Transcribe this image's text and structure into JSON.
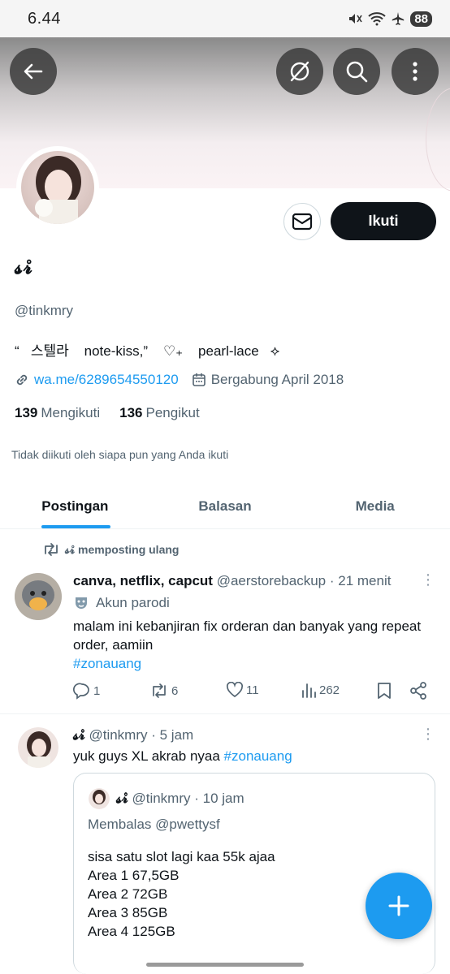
{
  "status_bar": {
    "time": "6.44",
    "battery": "88"
  },
  "profile": {
    "display_name": "𝓼𝓻̊",
    "handle": "@tinkmry",
    "bio": "“   스텔라    note-kiss,”    ♡₊    pearl-lace   ⟡",
    "link": "wa.me/6289654550120",
    "joined": "Bergabung April 2018",
    "following_count": "139",
    "following_label": "Mengikuti",
    "followers_count": "136",
    "followers_label": "Pengikut",
    "not_followed_text": "Tidak diikuti oleh siapa pun yang Anda ikuti",
    "follow_button": "Ikuti"
  },
  "tabs": [
    {
      "label": "Postingan"
    },
    {
      "label": "Balasan"
    },
    {
      "label": "Media"
    }
  ],
  "posts": [
    {
      "repost_label": "𝓼𝓻̊ memposting ulang",
      "name": "canva, netflix, capcut",
      "handle": "@aerstorebackup",
      "time": "· 21 menit",
      "badge": "Akun parodi",
      "text": "malam ini kebanjiran fix orderan dan banyak yang repeat order, aamiin",
      "hashtag": "#zonauang",
      "replies": "1",
      "reposts": "6",
      "likes": "11",
      "views": "262"
    },
    {
      "name": "𝓼𝓻̊",
      "handle": "@tinkmry",
      "time": "· 5 jam",
      "text": "yuk guys XL akrab nyaa ",
      "hashtag": "#zonauang",
      "quote": {
        "name": "𝓼𝓻̊",
        "handle": "@tinkmry",
        "time": "· 10 jam",
        "replying": "Membalas @pwettysf",
        "lines": [
          "sisa satu slot lagi kaa 55k ajaa",
          "Area 1 67,5GB",
          "Area 2 72GB",
          "Area 3 85GB",
          "Area 4 125GB"
        ]
      }
    }
  ],
  "colors": {
    "accent": "#1d9bf0",
    "text": "#0f1419",
    "muted": "#536471"
  }
}
